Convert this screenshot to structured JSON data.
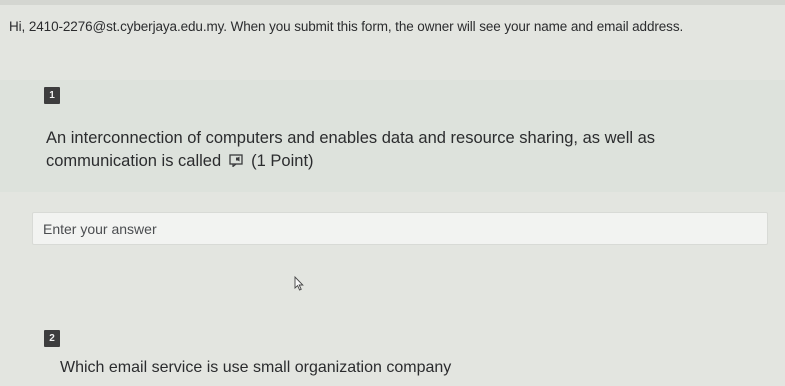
{
  "form": {
    "notice": "Hi, 2410-2276@st.cyberjaya.edu.my. When you submit this form, the owner will see your name and email address."
  },
  "questions": [
    {
      "number": "1",
      "text": "An interconnection of computers and enables data and resource sharing, as well as communication is called",
      "points": "(1 Point)",
      "answer_placeholder": "Enter your answer",
      "icon": "immersive-reader-icon"
    },
    {
      "number": "2",
      "text": "Which email service is use small organization company"
    }
  ],
  "colors": {
    "background": "#e3e5e0",
    "question_card": "#dde2dc",
    "badge": "#3d3d3e",
    "input_bg": "#f2f3f1"
  }
}
